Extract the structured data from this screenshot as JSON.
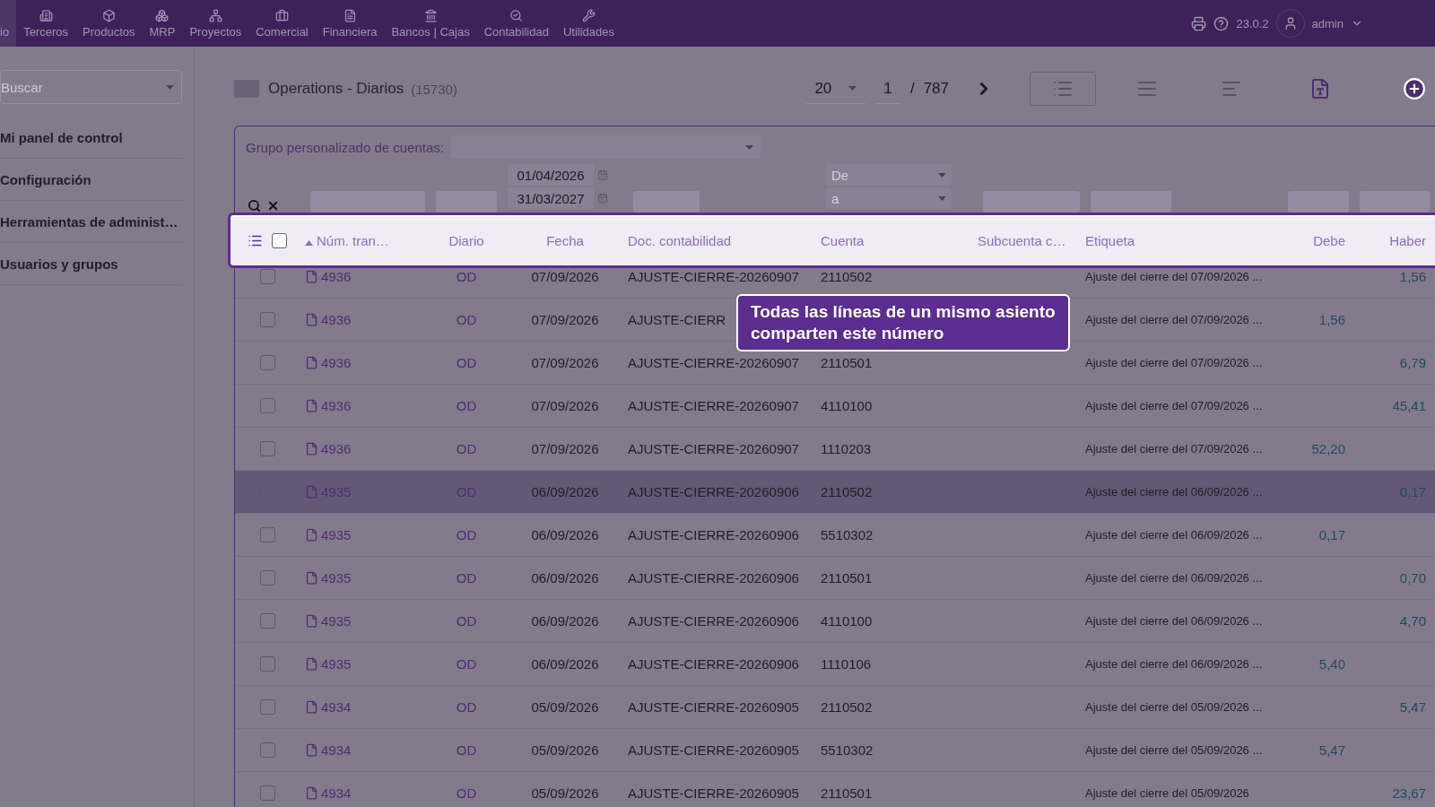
{
  "top_menu": [
    {
      "label": "io",
      "selected": true
    },
    {
      "label": "Terceros",
      "selected": false
    },
    {
      "label": "Productos",
      "selected": false
    },
    {
      "label": "MRP",
      "selected": false
    },
    {
      "label": "Proyectos",
      "selected": false
    },
    {
      "label": "Comercial",
      "selected": false
    },
    {
      "label": "Financiera",
      "selected": false
    },
    {
      "label": "Bancos | Cajas",
      "selected": false
    },
    {
      "label": "Contabilidad",
      "selected": false
    },
    {
      "label": "Utilidades",
      "selected": false
    }
  ],
  "version": "23.0.2",
  "user": "admin",
  "sidebar": {
    "search": {
      "placeholder": "Buscar"
    },
    "items": [
      "Mi panel de control",
      "Configuración",
      "Herramientas de administ…",
      "Usuarios y grupos"
    ]
  },
  "page": {
    "title": "Operations - Diarios",
    "count": "(15730)",
    "per_page": "20",
    "page": "1",
    "separator": "/",
    "pages": "787"
  },
  "view_modes": [
    {
      "selected": true
    },
    {
      "selected": false
    },
    {
      "selected": false
    }
  ],
  "filters": {
    "group_label": "Grupo personalizado de cuentas:",
    "date_from": "01/04/2026",
    "date_to": "31/03/2027",
    "account_from": {
      "placeholder": "De"
    },
    "account_to": {
      "placeholder": "a"
    }
  },
  "table": {
    "select_all_checked": false,
    "columns": [
      {
        "label": "Núm. tran…",
        "sorted": true
      },
      {
        "label": "Diario",
        "sorted": false
      },
      {
        "label": "Fecha",
        "sorted": false
      },
      {
        "label": "Doc. contabilidad",
        "sorted": false
      },
      {
        "label": "Cuenta",
        "sorted": false
      },
      {
        "label": "Subcuenta c…",
        "sorted": false
      },
      {
        "label": "Etiqueta",
        "sorted": false
      },
      {
        "label": "Debe",
        "sorted": false
      },
      {
        "label": "Haber",
        "sorted": false
      }
    ],
    "rows": [
      {
        "checked": false,
        "highlighted": false,
        "num": "4936",
        "journal": "OD",
        "date": "07/09/2026",
        "doc": "AJUSTE-CIERRE-20260907",
        "account": "2110502",
        "label": "Ajuste del cierre del 07/09/2026 ...",
        "credit": "1,56"
      },
      {
        "checked": false,
        "highlighted": false,
        "num": "4936",
        "journal": "OD",
        "date": "07/09/2026",
        "doc": "AJUSTE-CIERR",
        "label": "Ajuste del cierre del 07/09/2026 ...",
        "debit": "1,56"
      },
      {
        "checked": false,
        "highlighted": false,
        "num": "4936",
        "journal": "OD",
        "date": "07/09/2026",
        "doc": "AJUSTE-CIERRE-20260907",
        "account": "2110501",
        "label": "Ajuste del cierre del 07/09/2026 ...",
        "credit": "6,79"
      },
      {
        "checked": false,
        "highlighted": false,
        "num": "4936",
        "journal": "OD",
        "date": "07/09/2026",
        "doc": "AJUSTE-CIERRE-20260907",
        "account": "4110100",
        "label": "Ajuste del cierre del 07/09/2026 ...",
        "credit": "45,41"
      },
      {
        "checked": false,
        "highlighted": false,
        "num": "4936",
        "journal": "OD",
        "date": "07/09/2026",
        "doc": "AJUSTE-CIERRE-20260907",
        "account": "1110203",
        "label": "Ajuste del cierre del 07/09/2026 ...",
        "debit": "52,20"
      },
      {
        "checked": false,
        "highlighted": true,
        "num": "4935",
        "journal": "OD",
        "date": "06/09/2026",
        "doc": "AJUSTE-CIERRE-20260906",
        "account": "2110502",
        "label": "Ajuste del cierre del 06/09/2026 ...",
        "credit": "0,17"
      },
      {
        "checked": false,
        "highlighted": false,
        "num": "4935",
        "journal": "OD",
        "date": "06/09/2026",
        "doc": "AJUSTE-CIERRE-20260906",
        "account": "5510302",
        "label": "Ajuste del cierre del 06/09/2026 ...",
        "debit": "0,17"
      },
      {
        "checked": false,
        "highlighted": false,
        "num": "4935",
        "journal": "OD",
        "date": "06/09/2026",
        "doc": "AJUSTE-CIERRE-20260906",
        "account": "2110501",
        "label": "Ajuste del cierre del 06/09/2026 ...",
        "credit": "0,70"
      },
      {
        "checked": false,
        "highlighted": false,
        "num": "4935",
        "journal": "OD",
        "date": "06/09/2026",
        "doc": "AJUSTE-CIERRE-20260906",
        "account": "4110100",
        "label": "Ajuste del cierre del 06/09/2026 ...",
        "credit": "4,70"
      },
      {
        "checked": false,
        "highlighted": false,
        "num": "4935",
        "journal": "OD",
        "date": "06/09/2026",
        "doc": "AJUSTE-CIERRE-20260906",
        "account": "1110106",
        "label": "Ajuste del cierre del 06/09/2026 ...",
        "debit": "5,40"
      },
      {
        "checked": false,
        "highlighted": false,
        "num": "4934",
        "journal": "OD",
        "date": "05/09/2026",
        "doc": "AJUSTE-CIERRE-20260905",
        "account": "2110502",
        "label": "Ajuste del cierre del 05/09/2026 ...",
        "credit": "5,47"
      },
      {
        "checked": false,
        "highlighted": false,
        "num": "4934",
        "journal": "OD",
        "date": "05/09/2026",
        "doc": "AJUSTE-CIERRE-20260905",
        "account": "5510302",
        "label": "Ajuste del cierre del 05/09/2026 ...",
        "debit": "5,47"
      },
      {
        "checked": false,
        "highlighted": false,
        "num": "4934",
        "journal": "OD",
        "date": "05/09/2026",
        "doc": "AJUSTE-CIERRE-20260905",
        "account": "2110501",
        "label": "Ajuste del cierre del 05/09/2026",
        "credit": "23,67"
      }
    ]
  },
  "tour_tooltip": "Todas las líneas de un mismo asiento comparten este número"
}
